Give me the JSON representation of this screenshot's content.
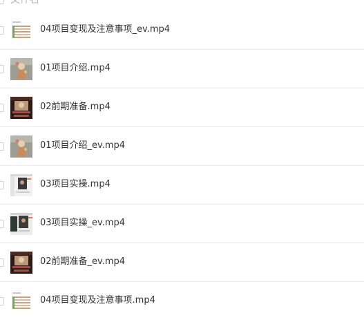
{
  "header": {
    "column_label": "文件名"
  },
  "files": [
    {
      "name": "04项目变现及注意事项_ev.mp4",
      "thumbnail": "list-thumb-icon"
    },
    {
      "name": "01项目介绍.mp4",
      "thumbnail": "fairy-thumb-icon"
    },
    {
      "name": "02前期准备.mp4",
      "thumbnail": "dark-video-thumb-icon"
    },
    {
      "name": "01项目介绍_ev.mp4",
      "thumbnail": "fairy-thumb-icon"
    },
    {
      "name": "03项目实操.mp4",
      "thumbnail": "screen-thumb-icon"
    },
    {
      "name": "03项目实操_ev.mp4",
      "thumbnail": "screen-thumb-icon"
    },
    {
      "name": "02前期准备_ev.mp4",
      "thumbnail": "dark-video-thumb-icon"
    },
    {
      "name": "04项目变现及注意事项.mp4",
      "thumbnail": "list-thumb-icon"
    }
  ]
}
